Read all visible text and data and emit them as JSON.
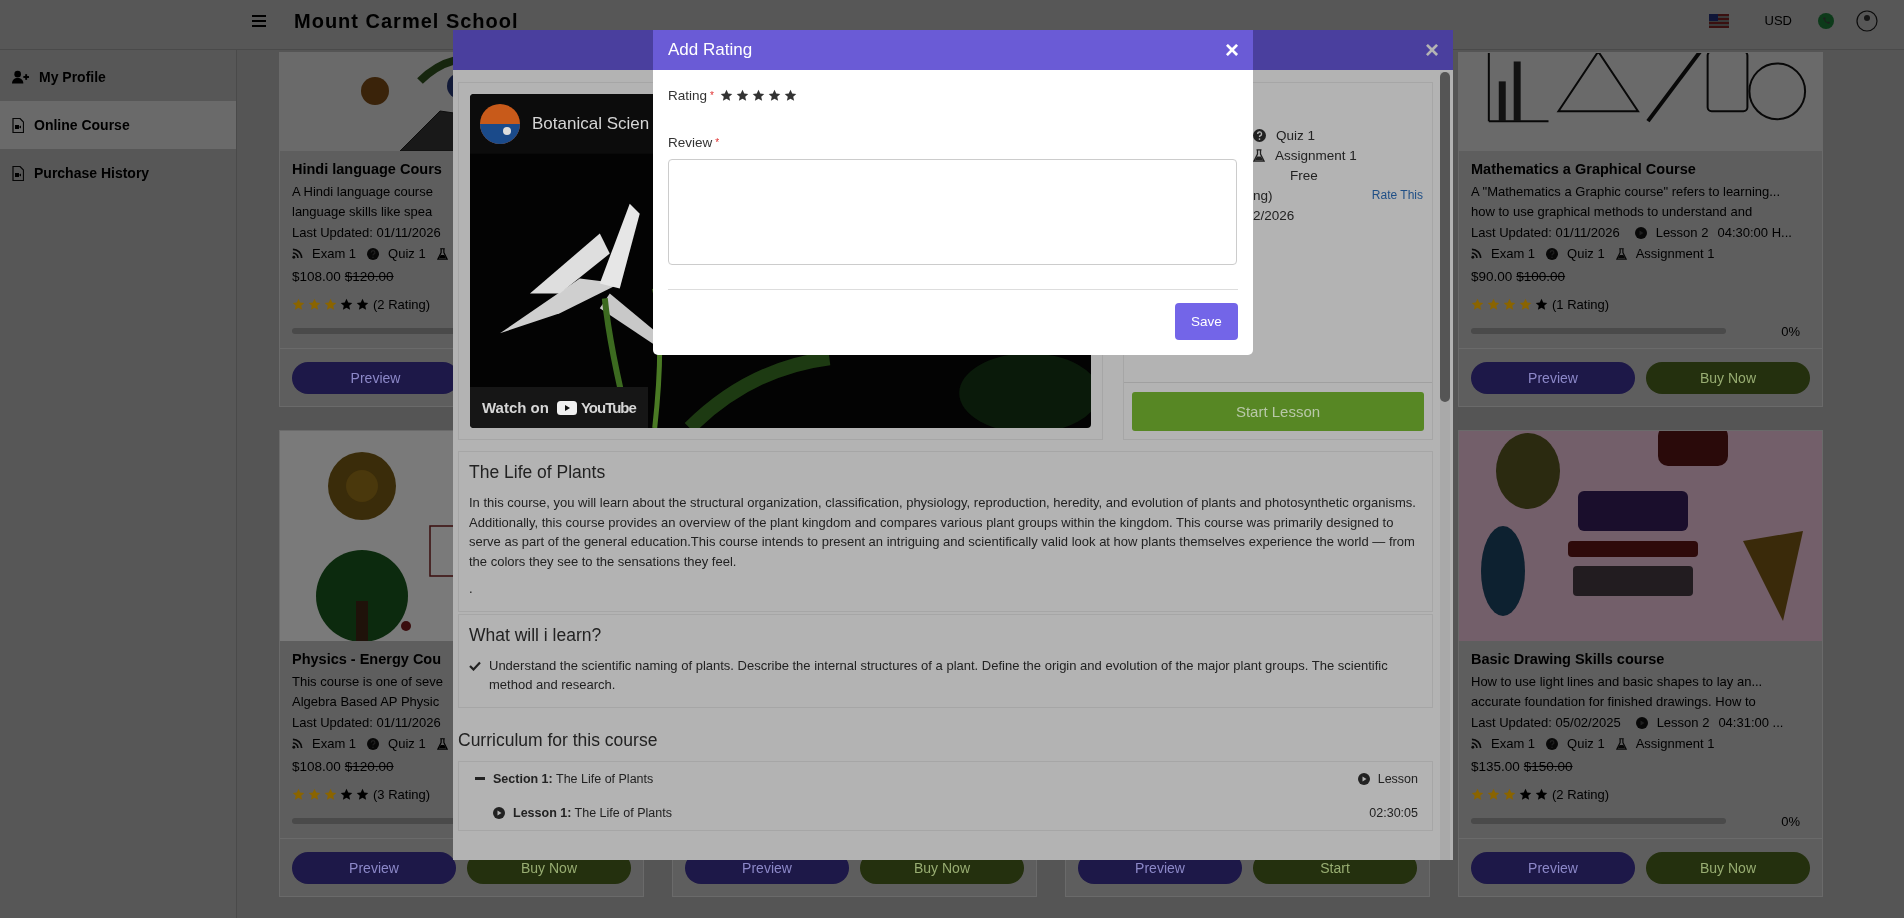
{
  "header": {
    "title": "Mount Carmel School",
    "currency": "USD"
  },
  "sidebar": {
    "items": [
      {
        "label": "My Profile",
        "selected": false
      },
      {
        "label": "Online Course",
        "selected": true
      },
      {
        "label": "Purchase History",
        "selected": false
      }
    ]
  },
  "course_columns": [
    {
      "cards": [
        {
          "title": "Hindi language Cours",
          "description": [
            "A Hindi language course",
            "language skills like spea"
          ],
          "updated": "Last Updated: 01/11/2026",
          "stats": [
            "Exam 1",
            "Quiz 1"
          ],
          "price": "$108.00",
          "old_price": "$120.00",
          "stars": 3,
          "rating": "(2 Rating)",
          "progress": {
            "level": 0
          },
          "buttons": [
            {
              "kind": "preview",
              "label": "Preview"
            }
          ]
        },
        {
          "title": "Physics - Energy Cou",
          "description": [
            "This course is one of seve",
            "Algebra Based AP Physic"
          ],
          "updated": "Last Updated: 01/11/2026",
          "stats": [
            "Exam 1",
            "Quiz 1"
          ],
          "price": "$108.00",
          "old_price": "$120.00",
          "stars": 3,
          "rating": "(3 Rating)",
          "progress": {
            "level": 0
          },
          "buttons": [
            {
              "kind": "preview",
              "label": "Preview"
            },
            {
              "kind": "buy",
              "label": "Buy Now"
            }
          ]
        }
      ]
    },
    {
      "cards": [
        {
          "buttons": [
            {
              "kind": "preview",
              "label": "Preview"
            },
            {
              "kind": "buy",
              "label": "Buy Now"
            }
          ]
        }
      ]
    },
    {
      "cards": [
        {
          "buttons": [
            {
              "kind": "preview",
              "label": "Preview"
            },
            {
              "kind": "start",
              "label": "Start"
            }
          ]
        }
      ]
    },
    {
      "cards": [
        {
          "title": "Mathematics a Graphical Course",
          "description": [
            "A \"Mathematics a Graphic course\" refers to learning...",
            "how to use graphical methods to understand and"
          ],
          "updated": "Last Updated: 01/11/2026",
          "lesson": "Lesson 2",
          "duration": "04:30:00 H...",
          "stats": [
            "Exam 1",
            "Quiz 1",
            "Assignment 1"
          ],
          "price": "$90.00",
          "old_price": "$100.00",
          "stars": 4,
          "rating": "(1 Rating)",
          "progress": {
            "level": 0,
            "text": "0%"
          },
          "buttons": [
            {
              "kind": "preview",
              "label": "Preview"
            },
            {
              "kind": "buy",
              "label": "Buy Now"
            }
          ]
        },
        {
          "title": "Basic Drawing Skills course",
          "description": [
            "How to use light lines and basic shapes to lay an...",
            "accurate foundation for finished drawings. How to"
          ],
          "updated": "Last Updated: 05/02/2025",
          "lesson": "Lesson 2",
          "duration": "04:31:00 ...",
          "stats": [
            "Exam 1",
            "Quiz 1",
            "Assignment 1"
          ],
          "price": "$135.00",
          "old_price": "$150.00",
          "stars": 3,
          "rating": "(2 Rating)",
          "progress": {
            "level": 0,
            "text": "0%"
          },
          "buttons": [
            {
              "kind": "preview",
              "label": "Preview"
            },
            {
              "kind": "buy",
              "label": "Buy Now"
            }
          ]
        }
      ]
    }
  ],
  "course_modal": {
    "close": "×",
    "video": {
      "channel_title": "Botanical Scien",
      "watch_on": "Watch on",
      "brand": "YouTube"
    },
    "details": [
      {
        "kind": "quiz",
        "text": "Quiz 1"
      },
      {
        "kind": "assignment",
        "text": "Assignment 1"
      },
      {
        "kind": "note",
        "text": "Free"
      },
      {
        "kind": "fragment",
        "text": "ng)",
        "link": "Rate This"
      },
      {
        "kind": "fragment",
        "text": "2/2026"
      }
    ],
    "start_button": "Start Lesson",
    "about": {
      "title": "The Life of Plants",
      "text": "In this course, you will learn about the structural organization, classification, physiology, reproduction, heredity, and evolution of plants and photosynthetic organisms. Additionally, this course provides an overview of the plant kingdom and compares various plant groups within the kingdom. This course was primarily designed to serve as part of the general education.This course intends to present an intriguing and scientifically valid look at how plants themselves experience the world — from the colors they see to the sensations they feel.",
      "note": "."
    },
    "learn": {
      "title": "What will i learn?",
      "items": [
        "Understand the scientific naming of plants. Describe the internal structures of a plant. Define the origin and evolution of the major plant groups. The scientific method and research."
      ]
    },
    "curriculum": {
      "title": "Curriculum for this course",
      "sections": [
        {
          "title": "**Section 1:** The Life of Plants",
          "type": "Lesson",
          "expanded": true,
          "lessons": [
            {
              "title": "**Lesson 1:** The Life of Plants",
              "duration": "02:30:05"
            }
          ]
        }
      ]
    }
  },
  "rating_modal": {
    "title": "Add Rating",
    "close": "×",
    "rating_label": "Rating",
    "review_label": "Review",
    "required_mark": "*",
    "save": "Save"
  }
}
